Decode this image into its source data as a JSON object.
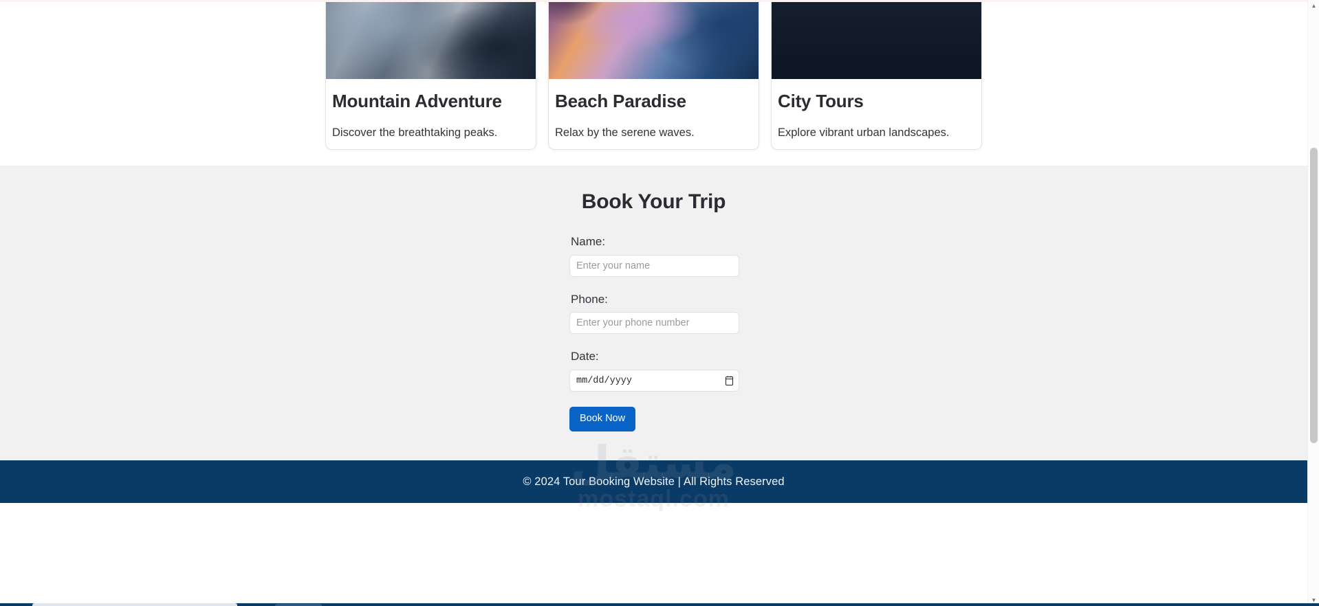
{
  "page": {
    "background_color": "#ffffff",
    "section_bg_color": "#f1f1f1",
    "footer_bg_color": "#0a3a66",
    "accent_color": "#0a64c8"
  },
  "tours": {
    "cards": [
      {
        "title": "Mountain Adventure",
        "description": "Discover the breathtaking peaks.",
        "image_name": "snowy-mountain-photo"
      },
      {
        "title": "Beach Paradise",
        "description": "Relax by the serene waves.",
        "image_name": "sunset-beach-waves-photo"
      },
      {
        "title": "City Tours",
        "description": "Explore vibrant urban landscapes.",
        "image_name": "city-skyline-dusk-photo"
      }
    ]
  },
  "booking": {
    "heading": "Book Your Trip",
    "fields": [
      {
        "label": "Name:",
        "placeholder": "Enter your name",
        "value": "",
        "type": "text"
      },
      {
        "label": "Phone:",
        "placeholder": "Enter your phone number",
        "value": "",
        "type": "tel"
      }
    ],
    "date": {
      "label": "Date:",
      "display_value": "mm/dd/yyyy",
      "icon_name": "calendar-picker-icon"
    },
    "submit_label": "Book Now"
  },
  "footer": {
    "text": "© 2024 Tour Booking Website | All Rights Reserved"
  },
  "watermark": {
    "arabic": "مستقل",
    "latin": "mostaql.com"
  },
  "scrollbar": {
    "up_arrow": "▲",
    "down_arrow": "▼"
  }
}
